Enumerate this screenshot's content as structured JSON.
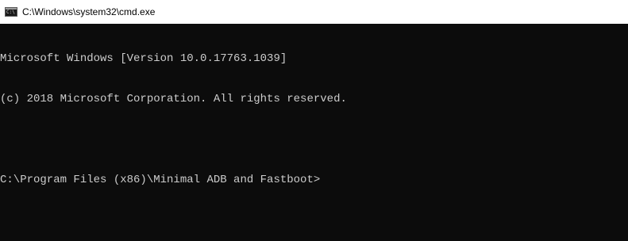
{
  "window": {
    "title": "C:\\Windows\\system32\\cmd.exe",
    "icon": "console-icon"
  },
  "console": {
    "lines": [
      "Microsoft Windows [Version 10.0.17763.1039]",
      "(c) 2018 Microsoft Corporation. All rights reserved.",
      "",
      "C:\\Program Files (x86)\\Minimal ADB and Fastboot>"
    ]
  },
  "colors": {
    "background": "#0c0c0c",
    "text": "#cccccc",
    "titlebar": "#ffffff"
  }
}
